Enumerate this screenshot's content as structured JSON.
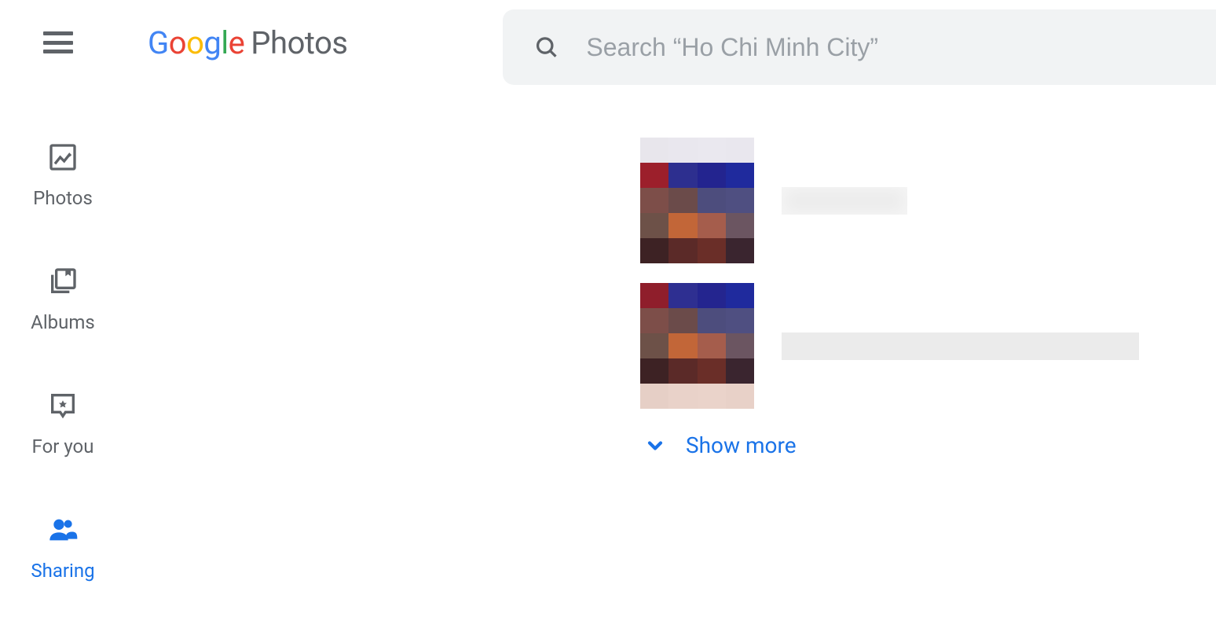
{
  "header": {
    "logo_text": "Google",
    "product": "Photos",
    "search_placeholder": "Search “Ho Chi Minh City”"
  },
  "sidebar": {
    "items": [
      {
        "id": "photos",
        "label": "Photos",
        "active": false
      },
      {
        "id": "albums",
        "label": "Albums",
        "active": false
      },
      {
        "id": "for-you",
        "label": "For you",
        "active": false
      },
      {
        "id": "sharing",
        "label": "Sharing",
        "active": true
      }
    ]
  },
  "content": {
    "show_more": "Show more"
  },
  "colors": {
    "accent": "#1a73e8",
    "muted": "#5f6368",
    "surface": "#f1f3f4"
  }
}
